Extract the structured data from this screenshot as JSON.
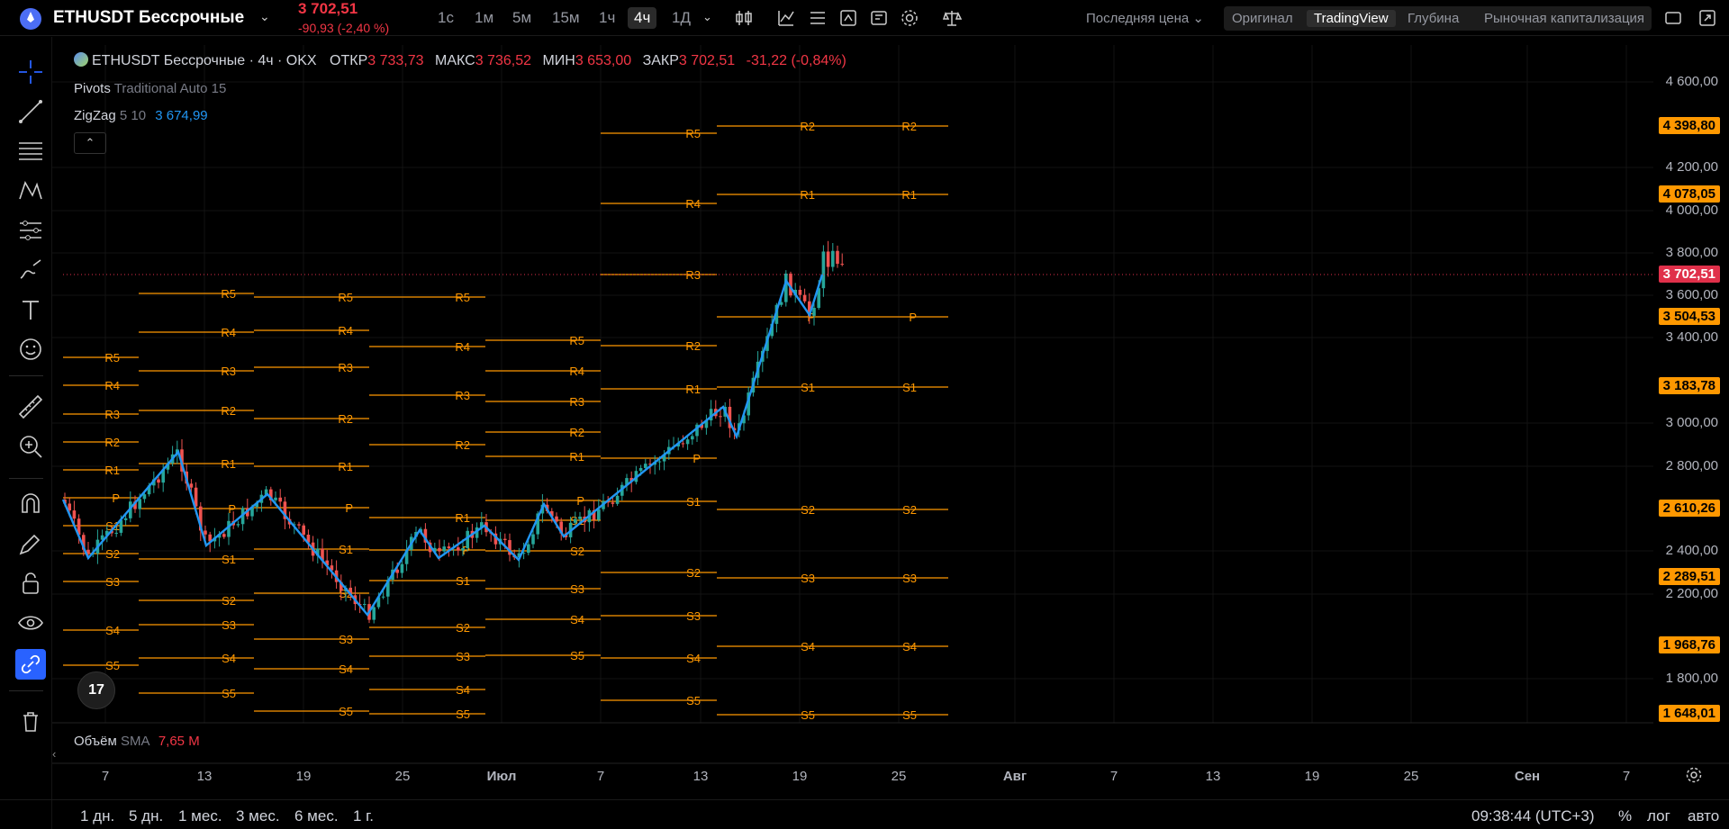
{
  "header": {
    "symbol": "ETHUSDT Бессрочные",
    "price": "3 702,51",
    "change": "-90,93 (-2,40 %)",
    "timeframes": [
      "1с",
      "1м",
      "5м",
      "15м",
      "1ч",
      "4ч",
      "1Д"
    ],
    "active_timeframe": "4ч",
    "price_type": "Последняя цена",
    "views": [
      "Оригинал",
      "TradingView",
      "Глубина",
      "Рыночная капитализация"
    ],
    "active_view": "TradingView"
  },
  "legend": {
    "title": "ETHUSDT Бессрочные · 4ч · OKX",
    "open_label": "ОТКР",
    "open": "3 733,73",
    "high_label": "МАКС",
    "high": "3 736,52",
    "low_label": "МИН",
    "low": "3 653,00",
    "close_label": "ЗАКР",
    "close": "3 702,51",
    "change": "-31,22 (-0,84%)"
  },
  "indicators": {
    "pivots_name": "Pivots",
    "pivots_params": "Traditional Auto 15",
    "zigzag_name": "ZigZag",
    "zigzag_params": "5 10",
    "zigzag_value": "3 674,99"
  },
  "volume": {
    "name": "Объём",
    "ma": "SMA",
    "value": "7,65 M"
  },
  "price_axis": {
    "labels": [
      "4 600,00",
      "4 200,00",
      "4 000,00",
      "3 800,00",
      "3 600,00",
      "3 400,00",
      "3 000,00",
      "2 800,00",
      "2 400,00",
      "2 200,00",
      "1 800,00"
    ],
    "tags": [
      "4 398,80",
      "4 078,05",
      "3 702,51",
      "3 504,53",
      "3 183,78",
      "2 610,26",
      "2 289,51",
      "1 968,76",
      "1 648,01"
    ]
  },
  "time_axis": [
    "7",
    "13",
    "19",
    "25",
    "Июл",
    "7",
    "13",
    "19",
    "25",
    "Авг",
    "7",
    "13",
    "19",
    "25",
    "Сен",
    "7"
  ],
  "footer": {
    "ranges": [
      "1 дн.",
      "5 дн.",
      "1 мес.",
      "3 мес.",
      "6 мес.",
      "1 г."
    ],
    "clock": "09:38:44 (UTC+3)",
    "percent": "%",
    "log": "лог",
    "auto": "авто"
  },
  "pivot_labels": {
    "r5": "R5",
    "r4": "R4",
    "r3": "R3",
    "r2": "R2",
    "r1": "R1",
    "p": "P",
    "s1": "S1",
    "s2": "S2",
    "s3": "S3",
    "s4": "S4",
    "s5": "S5"
  },
  "colors": {
    "pivot": "#ff9800",
    "zigzag": "#2196f3",
    "up": "#26a69a",
    "down": "#ef5350",
    "accent": "#2962ff"
  },
  "tvlogo": "17"
}
